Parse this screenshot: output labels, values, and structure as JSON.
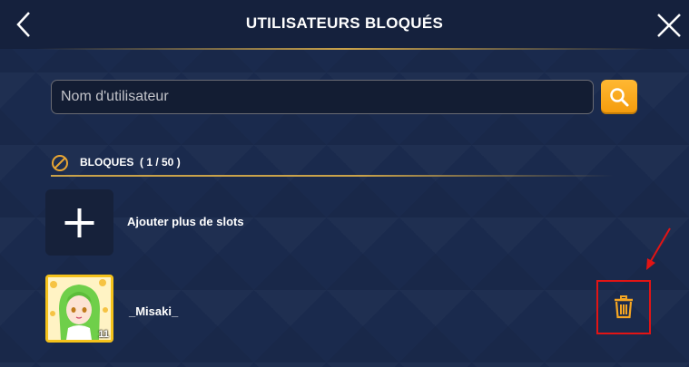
{
  "header": {
    "title": "UTILISATEURS BLOQUÉS",
    "back_icon": "chevron-left-icon",
    "close_icon": "close-icon"
  },
  "search": {
    "placeholder": "Nom d'utilisateur",
    "value": "",
    "button_icon": "search-icon"
  },
  "blocked_section": {
    "icon": "block-icon",
    "label": "BLOQUES  ( 1 / 50 )"
  },
  "add_slot": {
    "icon": "plus-icon",
    "label": "Ajouter plus de slots"
  },
  "blocked_users": [
    {
      "username": "_Misaki_",
      "level": "11",
      "delete_icon": "trash-icon"
    }
  ],
  "colors": {
    "background": "#1a2a4d",
    "accent_gold": "#c9a24a",
    "search_button": "#f49b0b",
    "highlight_red": "#e31414",
    "trash_icon": "#f5a623"
  }
}
